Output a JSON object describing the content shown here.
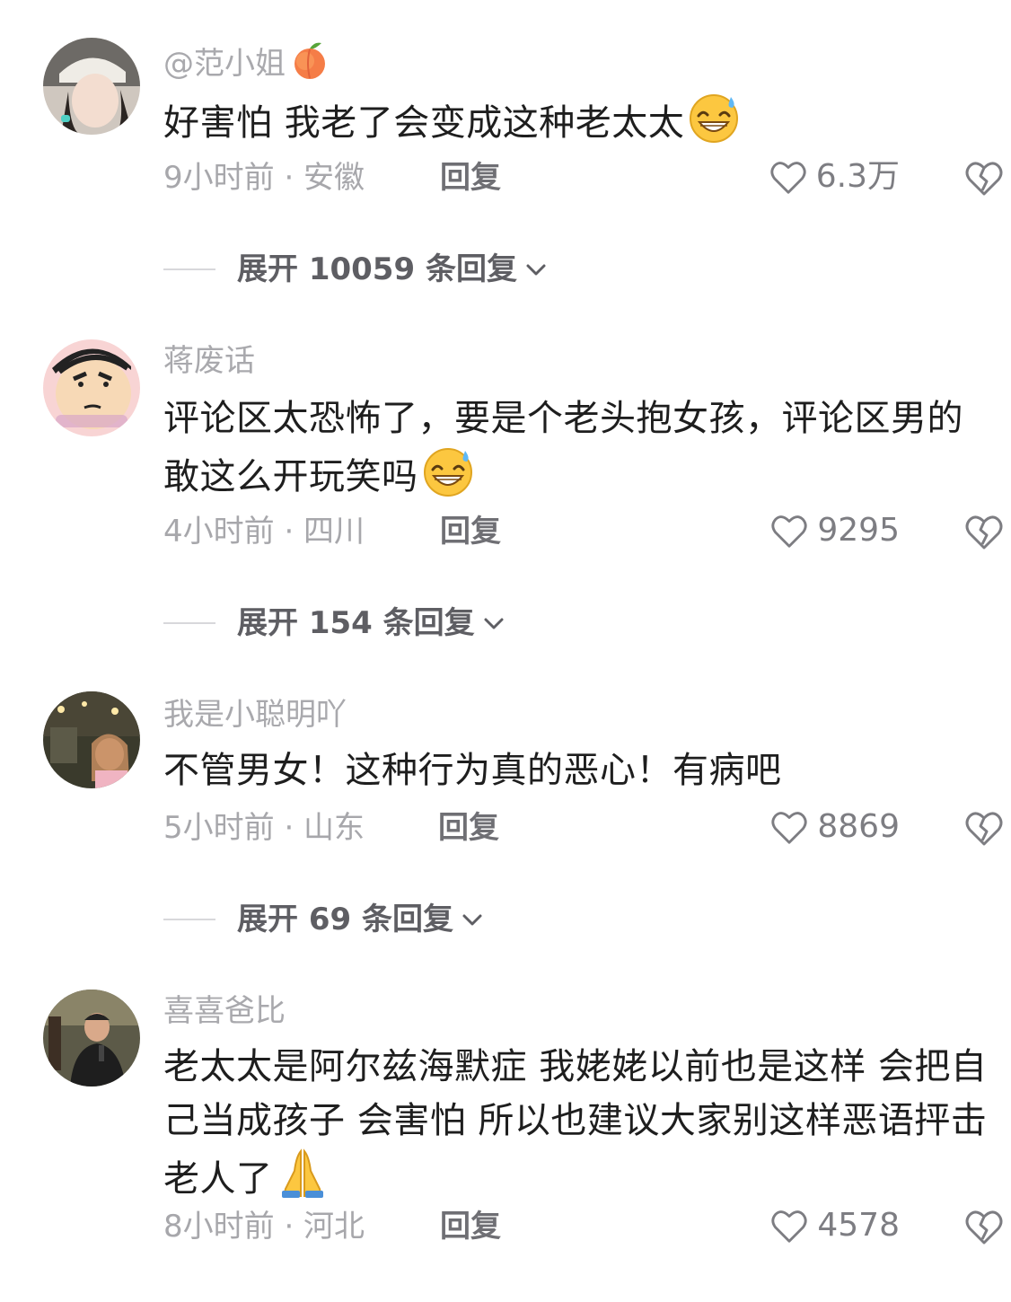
{
  "comments": [
    {
      "username": "@范小姐",
      "text": "好害怕 我老了会变成这种老太太",
      "time_location": "9小时前 · 安徽",
      "reply": "回复",
      "likes": "6.3万",
      "expand": "展开 10059 条回复",
      "username_emoji": "peach-emoji",
      "text_emoji": "grinning-sweat-emoji"
    },
    {
      "username": "蒋废话",
      "text": "评论区太恐怖了，要是个老头抱女孩，评论区男的敢这么开玩笑吗",
      "time_location": "4小时前 · 四川",
      "reply": "回复",
      "likes": "9295",
      "expand": "展开 154 条回复",
      "text_emoji": "grinning-sweat-emoji"
    },
    {
      "username": "我是小聪明吖",
      "text": "不管男女！这种行为真的恶心！有病吧",
      "time_location": "5小时前 · 山东",
      "reply": "回复",
      "likes": "8869",
      "expand": "展开 69 条回复"
    },
    {
      "username": "喜喜爸比",
      "text": "老太太是阿尔兹海默症 我姥姥以前也是这样 会把自己当成孩子 会害怕 所以也建议大家别这样恶语抨击老人了",
      "time_location": "8小时前 · 河北",
      "reply": "回复",
      "likes": "4578",
      "text_emoji": "folded-hands-emoji"
    }
  ],
  "colors": {
    "username": "#a9a9ad",
    "meta": "#a7a7ab",
    "text": "#1e1e1e",
    "reply": "#6f6f74"
  }
}
